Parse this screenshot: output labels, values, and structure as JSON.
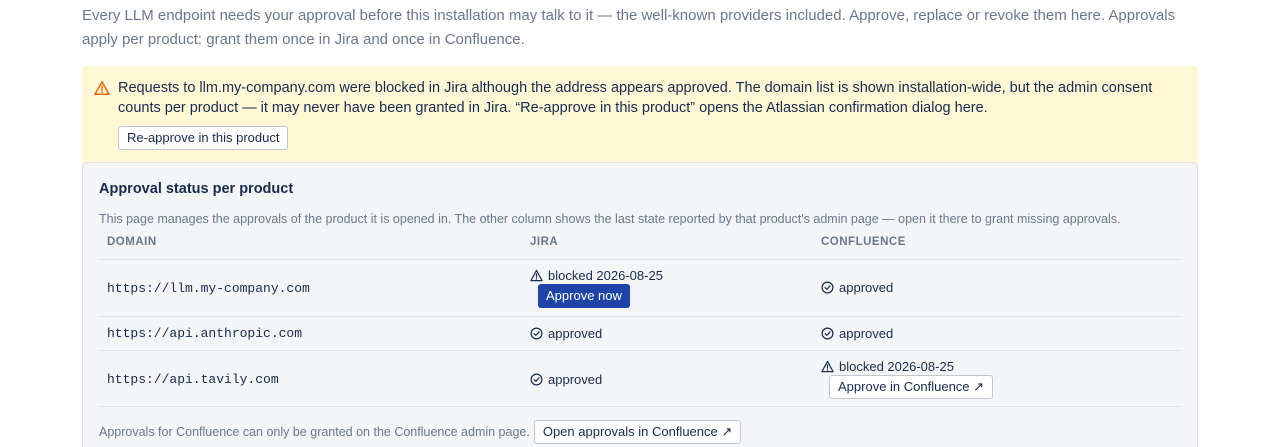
{
  "intro": "Every LLM endpoint needs your approval before this installation may talk to it — the well-known providers included. Approve, replace or revoke them here. Approvals apply per product: grant them once in Jira and once in Confluence.",
  "warning": {
    "icon": "warning-triangle-icon",
    "text": "Requests to llm.my-company.com were blocked in Jira although the address appears approved. The domain list is shown installation-wide, but the admin consent counts per product — it may never have been granted in Jira. “Re-approve in this product” opens the Atlassian confirmation dialog here.",
    "button": "Re-approve in this product",
    "color": "#fff7d6"
  },
  "panel": {
    "title": "Approval status per product",
    "description": "This page manages the approvals of the product it is opened in. The other column shows the last state reported by that product's admin page — open it there to grant missing approvals.",
    "columns": [
      "DOMAIN",
      "JIRA",
      "CONFLUENCE"
    ],
    "rows": [
      {
        "domain": "https://llm.my-company.com",
        "jira_status": "blocked 2026-08-25",
        "jira_action": "Approve now",
        "confluence_status": "approved"
      },
      {
        "domain": "https://api.anthropic.com",
        "jira_status": "approved",
        "confluence_status": "approved"
      },
      {
        "domain": "https://api.tavily.com",
        "jira_status": "approved",
        "confluence_status": "blocked 2026-08-25",
        "confluence_action": "Approve in Confluence ↗"
      }
    ],
    "footer_text": "Approvals for Confluence can only be granted on the Confluence admin page.",
    "footer_button": "Open approvals in Confluence ↗"
  },
  "colors": {
    "primary": "#1d44a6",
    "warning_icon": "#e56910",
    "muted": "#6b778c"
  }
}
